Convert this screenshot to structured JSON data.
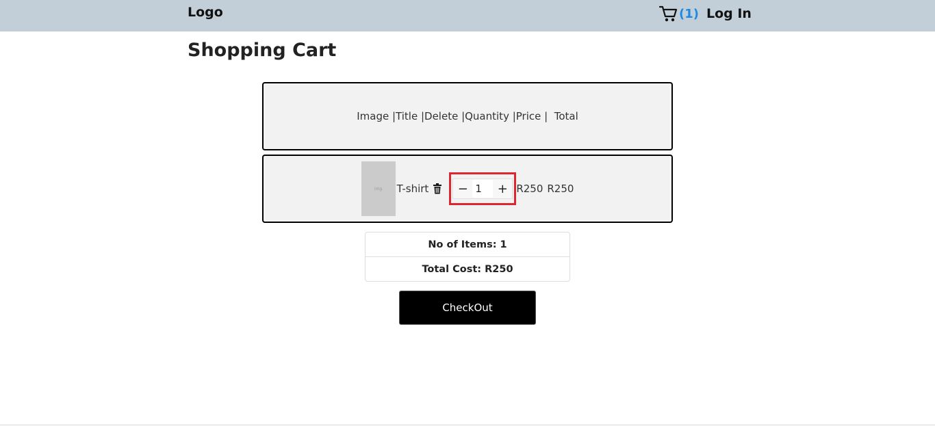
{
  "navbar": {
    "logo": "Logo",
    "cart_count": "(1)",
    "login_label": "Log In",
    "cart_icon": "shopping-cart-icon",
    "accent_color": "#1e88e5",
    "background_color": "#c3cfd8"
  },
  "page_title": "Shopping Cart",
  "cart_header": "Image |Title |Delete |Quantity |Price |  Total",
  "cart_items": [
    {
      "thumbnail_caption": "img",
      "title": "T-shirt",
      "delete_icon": "trash-icon",
      "quantity": "1",
      "decrement_label": "−",
      "increment_label": "+",
      "price": "R250",
      "total": "R250"
    }
  ],
  "summary": {
    "items_label": "No of Items: 1",
    "cost_label": "Total Cost: R250"
  },
  "checkout_label": "CheckOut",
  "highlight_color": "#dc2630"
}
